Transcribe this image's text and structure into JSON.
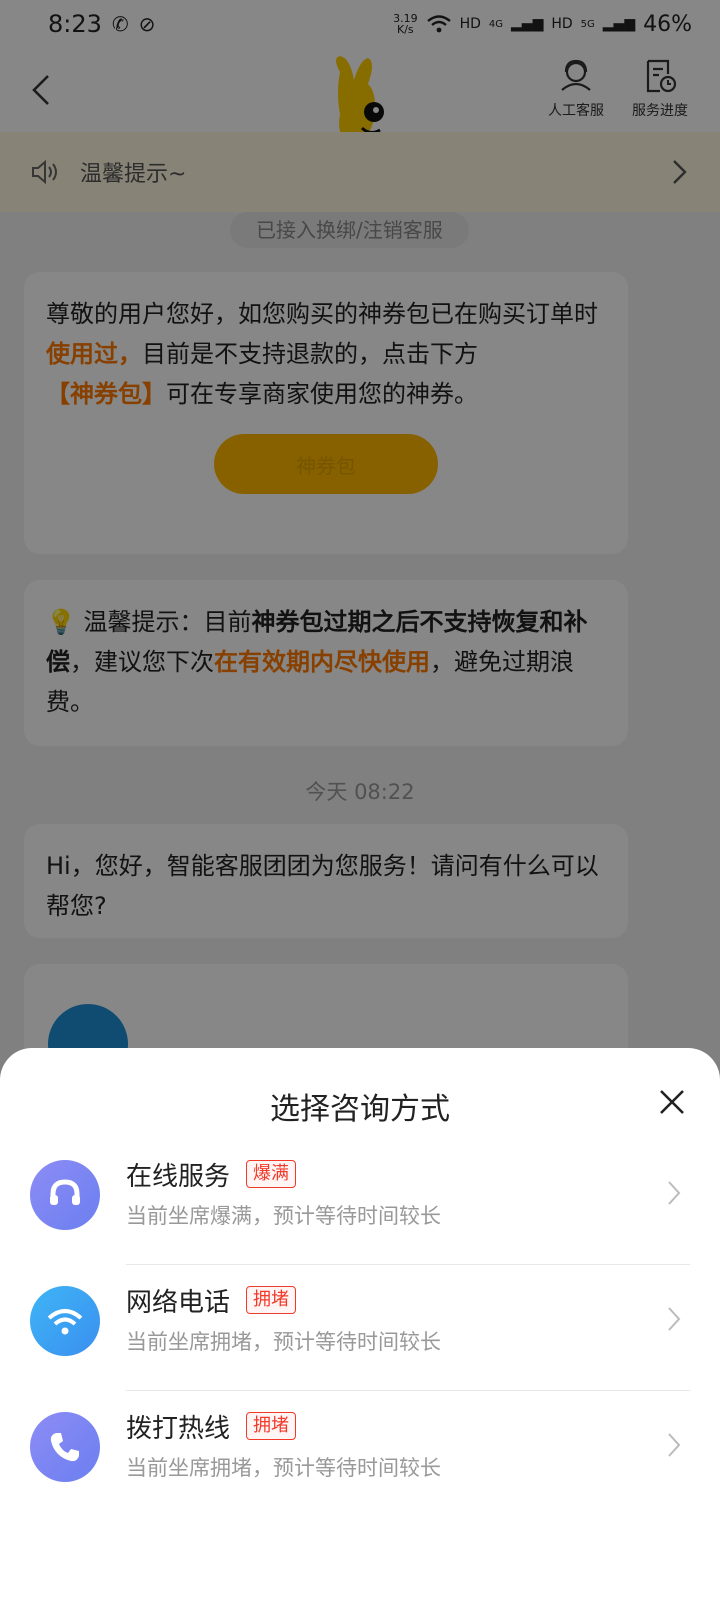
{
  "status_bar": {
    "time": "8:23",
    "speed": "3.19",
    "speed_unit": "K/s",
    "hd1": "HD",
    "net1": "4G",
    "hd2": "HD",
    "net2": "5G",
    "battery": "46%"
  },
  "header": {
    "customer_service": "人工客服",
    "service_progress": "服务进度"
  },
  "notice": {
    "text": "温馨提示~"
  },
  "chat": {
    "pill": "已接入换绑/注销客服",
    "msg1_a": "尊敬的用户您好，如您购买的神券包已在购买订单时",
    "msg1_b": "使用过，",
    "msg1_c": "目前是不支持退款的，点击下方",
    "msg1_d": "【神券包】",
    "msg1_e": "可在专享商家使用您的神券。",
    "coupon_button": "神券包",
    "msg2_a": "温馨提示：目前",
    "msg2_b": "神券包过期之后不支持恢复和补偿",
    "msg2_c": "，建议您下次",
    "msg2_d": "在有效期内尽快使用",
    "msg2_e": "，避免过期浪费。",
    "time": "今天 08:22",
    "msg3": "Hi，您好，智能客服团团为您服务！请问有什么可以帮您?"
  },
  "sheet": {
    "title": "选择咨询方式",
    "options": [
      {
        "name": "在线服务",
        "tag": "爆满",
        "desc": "当前坐席爆满，预计等待时间较长",
        "icon": "headset-icon"
      },
      {
        "name": "网络电话",
        "tag": "拥堵",
        "desc": "当前坐席拥堵，预计等待时间较长",
        "icon": "wifi-icon"
      },
      {
        "name": "拨打热线",
        "tag": "拥堵",
        "desc": "当前坐席拥堵，预计等待时间较长",
        "icon": "phone-icon"
      }
    ]
  }
}
